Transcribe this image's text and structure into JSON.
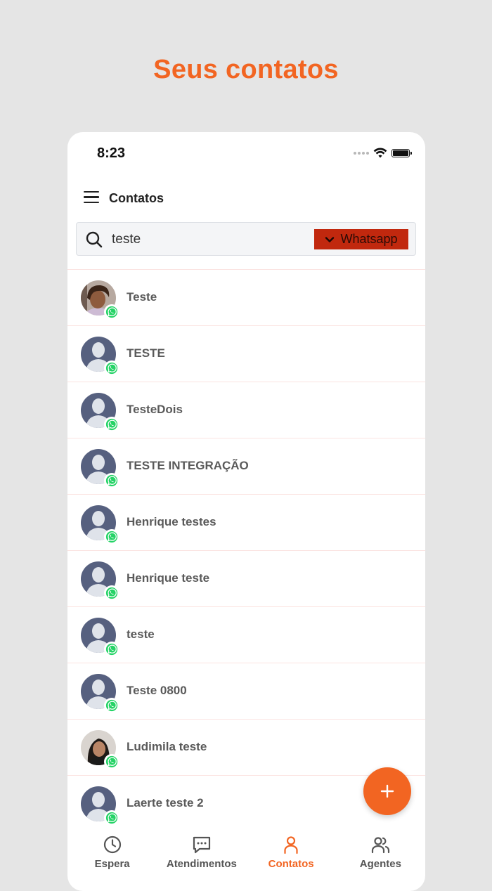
{
  "headline": "Seus contatos",
  "status_bar": {
    "time": "8:23"
  },
  "header": {
    "title": "Contatos",
    "menu_icon": "hamburger-menu-icon"
  },
  "search": {
    "value": "teste",
    "placeholder": "",
    "channel_filter": "Whatsapp"
  },
  "contacts": [
    {
      "name": "Teste",
      "avatar": "photo",
      "channel": "whatsapp"
    },
    {
      "name": "TESTE",
      "avatar": "default",
      "channel": "whatsapp"
    },
    {
      "name": "TesteDois",
      "avatar": "default",
      "channel": "whatsapp"
    },
    {
      "name": "TESTE INTEGRAÇÃO",
      "avatar": "default",
      "channel": "whatsapp"
    },
    {
      "name": "Henrique testes",
      "avatar": "default",
      "channel": "whatsapp"
    },
    {
      "name": "Henrique teste",
      "avatar": "default",
      "channel": "whatsapp"
    },
    {
      "name": "teste",
      "avatar": "default",
      "channel": "whatsapp"
    },
    {
      "name": "Teste 0800",
      "avatar": "default",
      "channel": "whatsapp"
    },
    {
      "name": "Ludimila teste",
      "avatar": "photo",
      "channel": "whatsapp"
    },
    {
      "name": "Laerte teste 2",
      "avatar": "default",
      "channel": "whatsapp"
    }
  ],
  "fab": {
    "icon": "plus-icon"
  },
  "bottom_nav": [
    {
      "label": "Espera",
      "icon": "clock-icon",
      "active": false
    },
    {
      "label": "Atendimentos",
      "icon": "chat-bubble-icon",
      "active": false
    },
    {
      "label": "Contatos",
      "icon": "person-icon",
      "active": true
    },
    {
      "label": "Agentes",
      "icon": "group-icon",
      "active": false
    }
  ],
  "colors": {
    "accent": "#f26522",
    "channel_filter_bg": "#c1280e",
    "whatsapp_green": "#25d366",
    "default_avatar": "#56607f"
  }
}
